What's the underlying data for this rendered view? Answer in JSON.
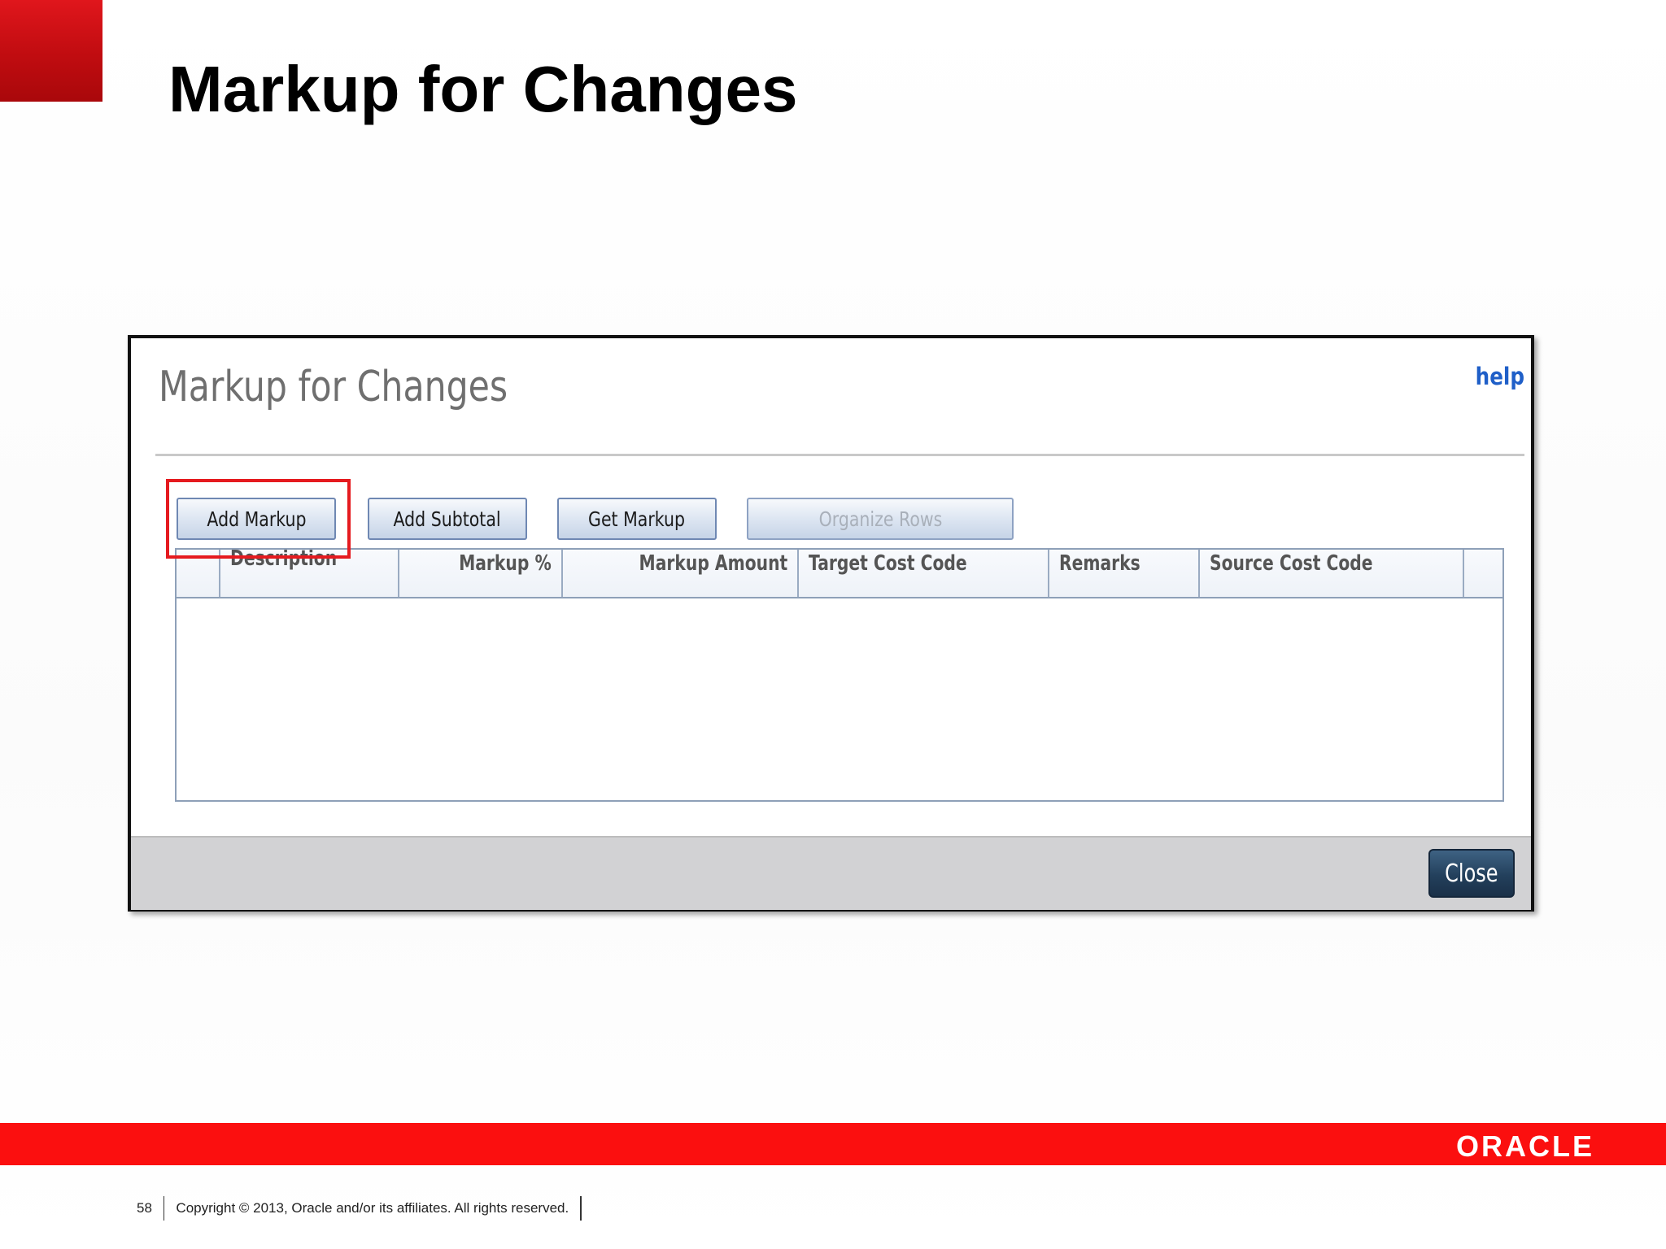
{
  "slide": {
    "title": "Markup for Changes",
    "page_number": "58",
    "copyright": "Copyright © 2013, Oracle and/or its affiliates. All rights reserved.",
    "brand_logo": "ORACLE",
    "brand_color": "#fb0f0f",
    "highlight_color": "#e51a1f"
  },
  "dialog": {
    "title": "Markup for Changes",
    "help_label": "help",
    "toolbar": {
      "add_markup_label": "Add Markup",
      "add_subtotal_label": "Add Subtotal",
      "get_markup_label": "Get Markup",
      "organize_rows_label": "Organize Rows"
    },
    "grid": {
      "columns": [
        "",
        "Description",
        "Markup %",
        "Markup Amount",
        "Target Cost Code",
        "Remarks",
        "Source Cost Code",
        ""
      ],
      "rows": []
    },
    "close_label": "Close"
  }
}
